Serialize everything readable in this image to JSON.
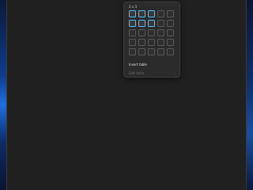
{
  "table_picker": {
    "grid_size_label": "2 x 3",
    "rows": 5,
    "cols": 5,
    "selected_rows": 2,
    "selected_cols": 3,
    "insert_label": "Insert table",
    "edit_label": "Edit table",
    "edit_chevron": "›",
    "accent_color": "#4cc2ff"
  }
}
